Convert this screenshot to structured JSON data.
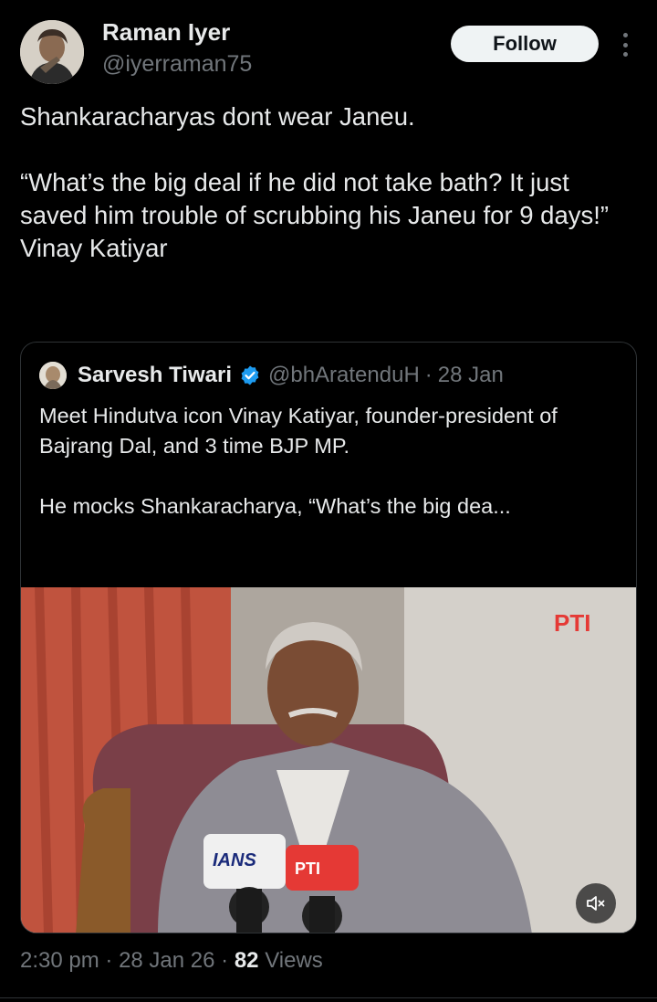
{
  "author": {
    "display_name": "Raman Iyer",
    "handle": "@iyerraman75",
    "follow_label": "Follow"
  },
  "tweet": {
    "text": "Shankaracharyas dont wear Janeu.\n\n“What’s the big deal if he did not take bath? It just saved him trouble of scrubbing his Janeu for 9 days!”\nVinay Katiyar"
  },
  "quote": {
    "display_name": "Sarvesh Tiwari",
    "handle": "@bhAratenduH",
    "separator": "·",
    "date": "28 Jan",
    "text": "Meet Hindutva icon Vinay Katiyar, founder-president of Bajrang Dal, and 3 time BJP MP.\n\nHe mocks Shankaracharya, “What’s the big dea...",
    "media": {
      "watermark": "PTI",
      "mic_labels": [
        "IANS",
        "PTI"
      ]
    }
  },
  "meta": {
    "time": "2:30 pm",
    "sep1": "·",
    "date": "28 Jan 26",
    "sep2": "·",
    "views_count": "82",
    "views_label": "Views"
  },
  "colors": {
    "background": "#000000",
    "text_primary": "#e7e9ea",
    "text_secondary": "#71767b",
    "verified": "#1d9bf0",
    "border": "#2f3336"
  }
}
